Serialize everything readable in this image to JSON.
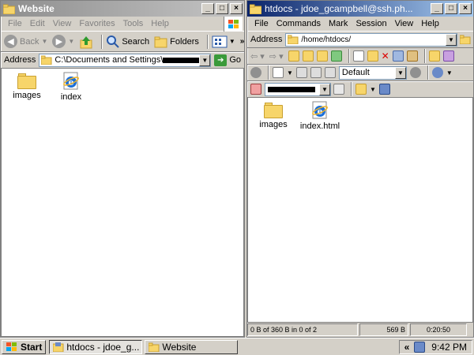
{
  "left_window": {
    "title": "Website",
    "menu": [
      "File",
      "Edit",
      "View",
      "Favorites",
      "Tools",
      "Help"
    ],
    "toolbar": {
      "back": "Back",
      "search": "Search",
      "folders": "Folders"
    },
    "address_label": "Address",
    "address_value": "C:\\Documents and Settings\\",
    "go": "Go",
    "files": [
      {
        "name": "images",
        "icon": "folder-icon"
      },
      {
        "name": "index",
        "icon": "ie-document-icon"
      }
    ]
  },
  "right_window": {
    "title": "htdocs - jdoe_gcampbell@ssh.ph...",
    "menu": [
      "File",
      "Commands",
      "Mark",
      "Session",
      "View",
      "Help"
    ],
    "address_label": "Address",
    "address_value": "/home/htdocs/",
    "profile_combo": "Default",
    "files": [
      {
        "name": "images",
        "icon": "folder-icon"
      },
      {
        "name": "index.html",
        "icon": "ie-document-icon"
      }
    ],
    "status": {
      "selection": "0 B of 360 B in 0 of 2",
      "size": "569 B",
      "time": "0:20:50"
    }
  },
  "taskbar": {
    "start": "Start",
    "tasks": [
      {
        "label": "htdocs - jdoe_g...",
        "active": true
      },
      {
        "label": "Website",
        "active": false
      }
    ],
    "tray_arrow": "«",
    "clock": "9:42 PM"
  },
  "colors": {
    "folder": "#f7d56a",
    "ie_blue": "#1c6fd8",
    "titlebar_active": "#0a246a"
  }
}
